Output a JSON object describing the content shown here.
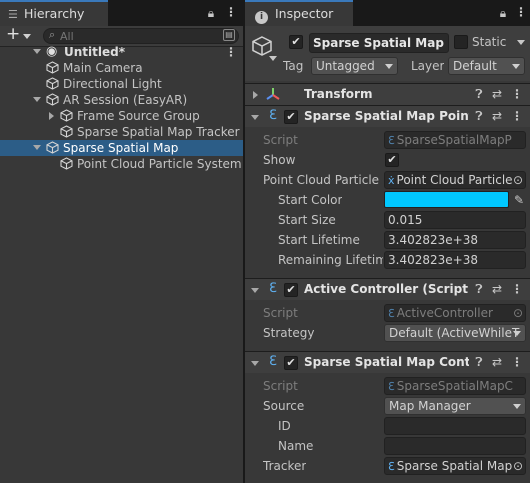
{
  "hierarchy": {
    "tab_label": "Hierarchy",
    "add_label": "+",
    "search_placeholder": "All",
    "scene_name": "Untitled*",
    "items": [
      {
        "label": "Main Camera",
        "depth": 1,
        "selected": false,
        "expandable": false
      },
      {
        "label": "Directional Light",
        "depth": 1,
        "selected": false,
        "expandable": false
      },
      {
        "label": "AR Session (EasyAR)",
        "depth": 1,
        "selected": false,
        "expandable": true,
        "expanded": true
      },
      {
        "label": "Frame Source Group",
        "depth": 2,
        "selected": false,
        "expandable": true,
        "expanded": false
      },
      {
        "label": "Sparse Spatial Map Tracker",
        "depth": 2,
        "selected": false,
        "expandable": false
      },
      {
        "label": "Sparse Spatial Map",
        "depth": 1,
        "selected": true,
        "expandable": true,
        "expanded": true
      },
      {
        "label": "Point Cloud Particle System",
        "depth": 2,
        "selected": false,
        "expandable": false
      }
    ]
  },
  "inspector": {
    "tab_label": "Inspector",
    "object_name": "Sparse Spatial Map",
    "active": true,
    "static_label": "Static",
    "static_checked": false,
    "tag_label": "Tag",
    "tag_value": "Untagged",
    "layer_label": "Layer",
    "layer_value": "Default",
    "transform_title": "Transform",
    "components": [
      {
        "title": "Sparse Spatial Map Point Cl",
        "enabled": true,
        "script_label": "Script",
        "script_value": "SparseSpatialMapP",
        "show_label": "Show",
        "show_checked": true,
        "pcps_label": "Point Cloud Particle S",
        "pcps_value": "Point Cloud Particle",
        "start_color_label": "Start Color",
        "start_color": "#00c8ff",
        "start_size_label": "Start Size",
        "start_size": "0.015",
        "start_lifetime_label": "Start Lifetime",
        "start_lifetime": "3.402823e+38",
        "remaining_lifetime_label": "Remaining Lifetime",
        "remaining_lifetime": "3.402823e+38"
      },
      {
        "title": "Active Controller (Script)",
        "enabled": true,
        "script_label": "Script",
        "script_value": "ActiveController",
        "strategy_label": "Strategy",
        "strategy_value": "Default (ActiveWhileT"
      },
      {
        "title": "Sparse Spatial Map Controll",
        "enabled": true,
        "script_label": "Script",
        "script_value": "SparseSpatialMapC",
        "source_label": "Source",
        "source_value": "Map Manager",
        "id_label": "ID",
        "id_value": "",
        "name_label": "Name",
        "name_value": "",
        "tracker_label": "Tracker",
        "tracker_value": "Sparse Spatial Map"
      }
    ]
  },
  "colors": {
    "selection": "#2c5d87",
    "tab_accent": "#3a79bb",
    "start_color_swatch": "#00c8ff"
  },
  "icons": [
    "lock-icon",
    "menu-icon",
    "search-icon",
    "cube-icon",
    "unity-scene-icon",
    "script-icon",
    "help-icon",
    "sliders-icon",
    "kebab-icon",
    "eyedropper-icon",
    "target-icon",
    "transform-icon",
    "particle-icon"
  ]
}
